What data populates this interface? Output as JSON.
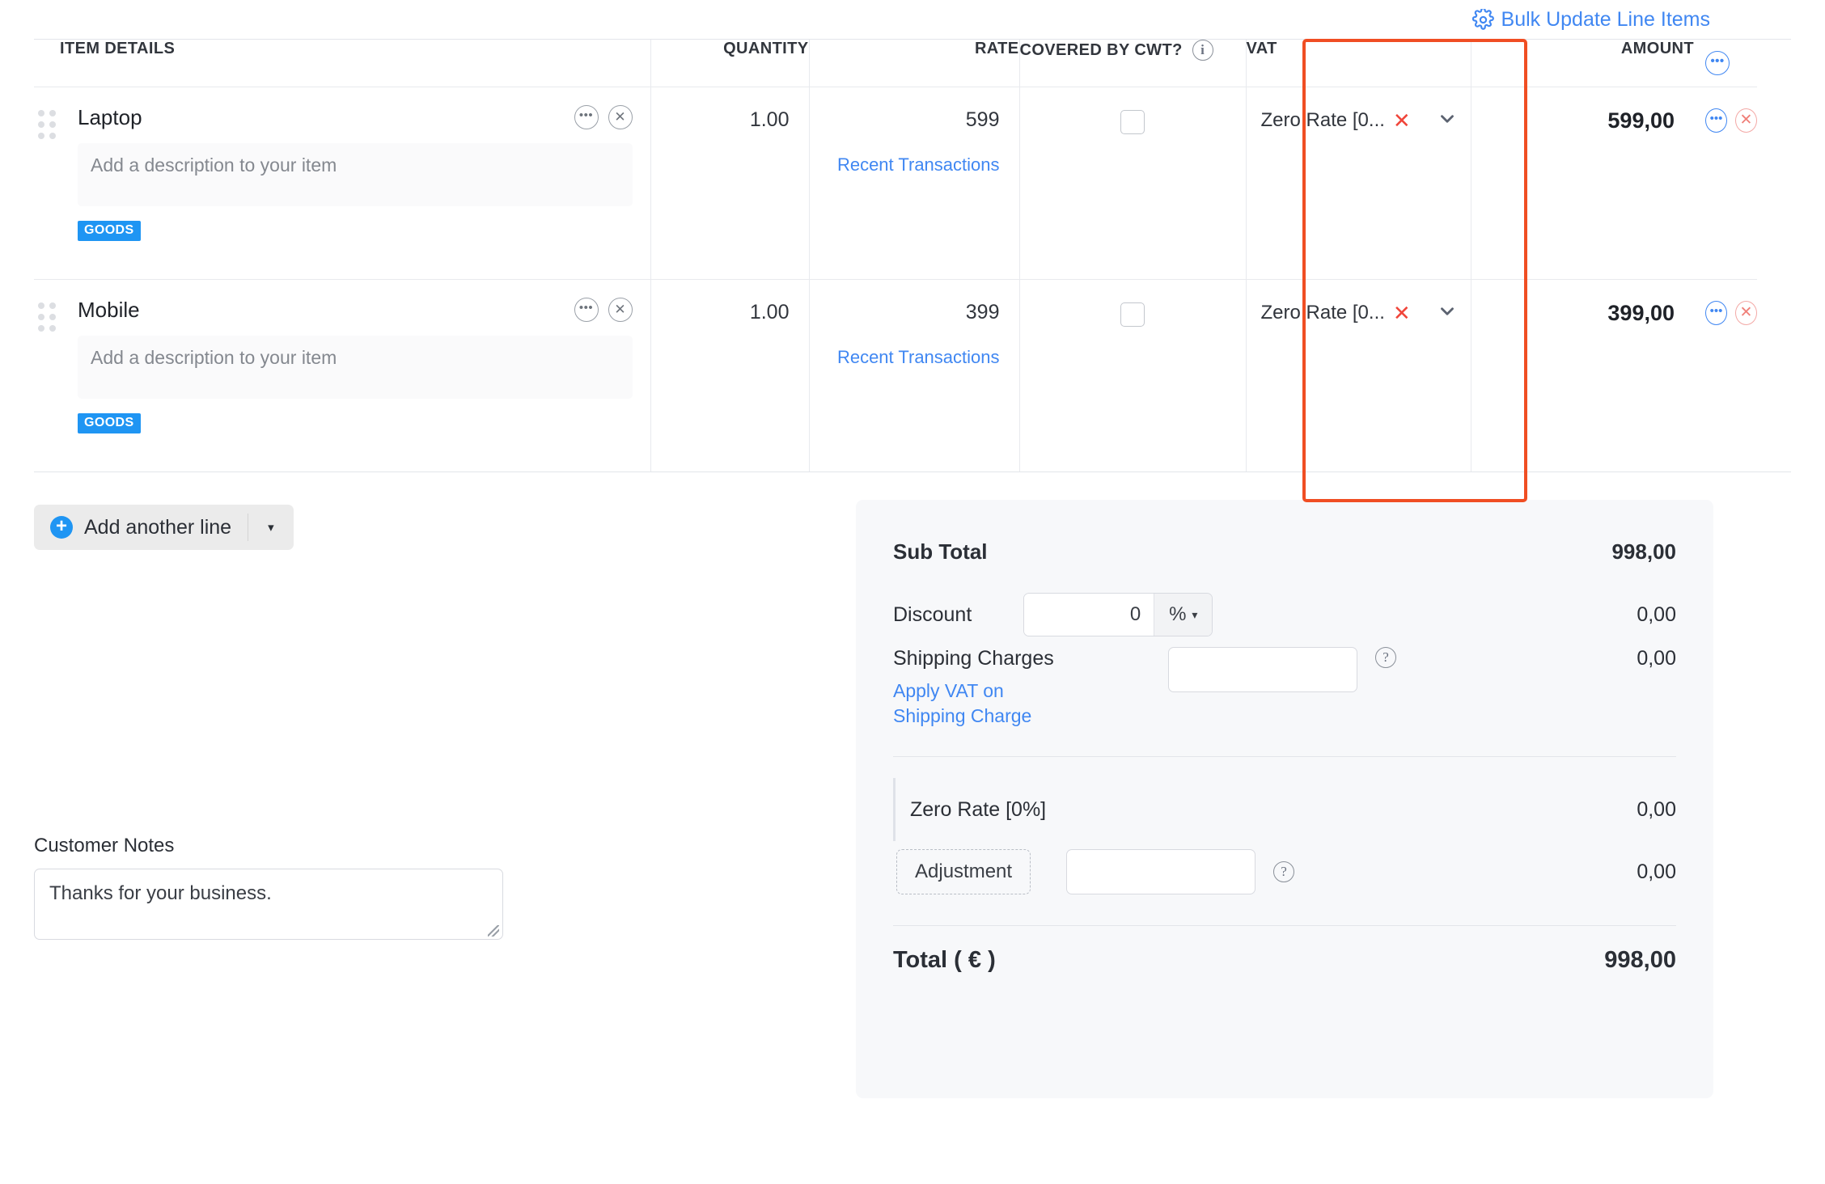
{
  "toolbar": {
    "bulk_update_label": "Bulk Update Line Items",
    "gear_icon": "gear-icon"
  },
  "table": {
    "headers": {
      "item_details": "ITEM DETAILS",
      "quantity": "QUANTITY",
      "rate": "RATE",
      "covered_by_cwt": "COVERED BY CWT?",
      "vat": "VAT",
      "amount": "AMOUNT"
    },
    "rows": [
      {
        "name": "Laptop",
        "description_placeholder": "Add a description to your item",
        "tag": "GOODS",
        "quantity": "1.00",
        "rate": "599",
        "recent_link": "Recent Transactions",
        "covered_by_cwt": false,
        "vat": "Zero Rate [0...",
        "amount": "599,00"
      },
      {
        "name": "Mobile",
        "description_placeholder": "Add a description to your item",
        "tag": "GOODS",
        "quantity": "1.00",
        "rate": "399",
        "recent_link": "Recent Transactions",
        "covered_by_cwt": false,
        "vat": "Zero Rate [0...",
        "amount": "399,00"
      }
    ],
    "highlight_color": "#f04e23"
  },
  "add_line": {
    "label": "Add another line",
    "caret": "▾"
  },
  "notes": {
    "label": "Customer Notes",
    "value": "Thanks for your business."
  },
  "summary": {
    "sub_total_label": "Sub Total",
    "sub_total_value": "998,00",
    "discount_label": "Discount",
    "discount_value": "0",
    "discount_unit": "%",
    "discount_amount": "0,00",
    "shipping_label": "Shipping Charges",
    "shipping_value": "",
    "shipping_amount": "0,00",
    "apply_vat_link": "Apply VAT on Shipping Charge",
    "vat_line_label": "Zero Rate [0%]",
    "vat_line_amount": "0,00",
    "adjustment_label": "Adjustment",
    "adjustment_value": "",
    "adjustment_amount": "0,00",
    "total_label": "Total ( € )",
    "total_value": "998,00"
  },
  "colors": {
    "link": "#4087f2",
    "tag": "#1f95f3",
    "highlight": "#f04e23",
    "danger": "#f0453a"
  }
}
